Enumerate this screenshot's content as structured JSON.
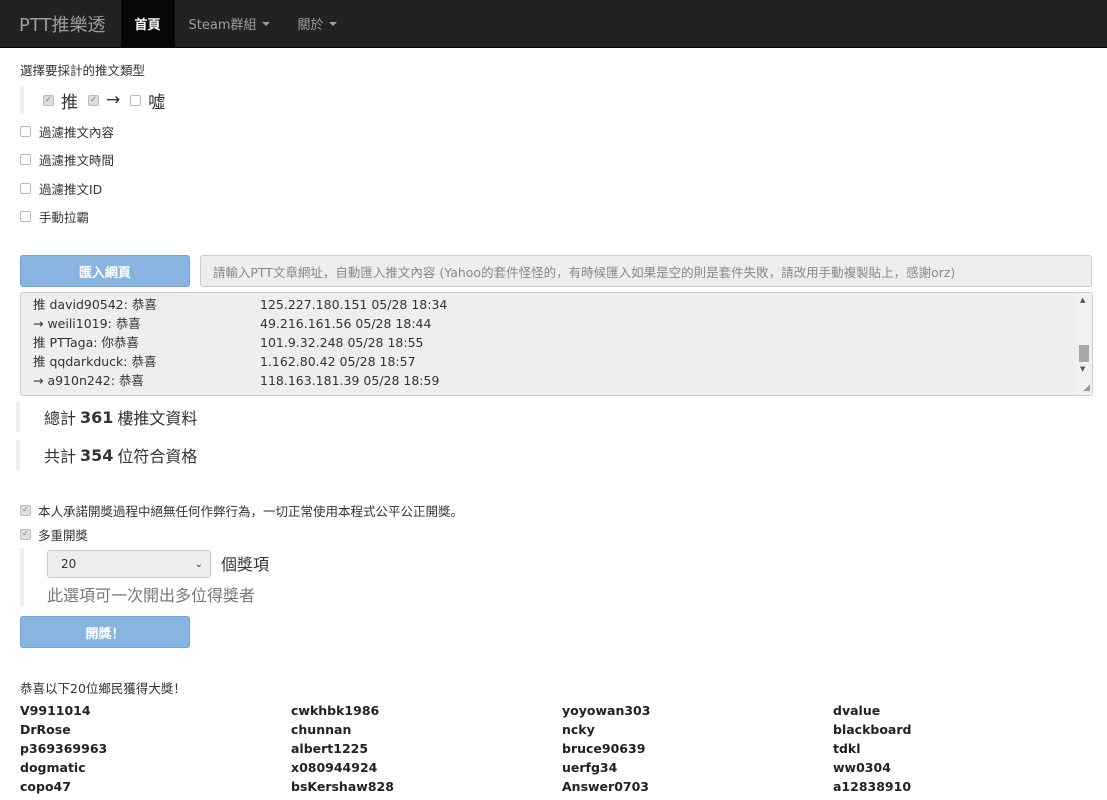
{
  "nav": {
    "brand": "PTT推樂透",
    "items": [
      {
        "label": "首頁",
        "active": true,
        "dropdown": false
      },
      {
        "label": "Steam群組",
        "active": false,
        "dropdown": true
      },
      {
        "label": "關於",
        "active": false,
        "dropdown": true
      }
    ]
  },
  "types": {
    "label": "選擇要採計的推文類型",
    "options": [
      {
        "label": "推",
        "checked": true
      },
      {
        "label": "→",
        "checked": true
      },
      {
        "label": "噓",
        "checked": false
      }
    ]
  },
  "filters": [
    {
      "label": "過濾推文內容",
      "checked": false
    },
    {
      "label": "過濾推文時間",
      "checked": false
    },
    {
      "label": "過濾推文ID",
      "checked": false
    },
    {
      "label": "手動拉霸",
      "checked": false
    }
  ],
  "import": {
    "button": "匯入網頁",
    "placeholder": "請輸入PTT文章網址，自動匯入推文內容 (Yahoo的套件怪怪的，有時候匯入如果是空的則是套件失敗，請改用手動複製貼上，感謝orz)"
  },
  "comments": [
    {
      "who": "推 david90542: 恭喜",
      "meta": "125.227.180.151 05/28 18:34"
    },
    {
      "who": "→ weili1019: 恭喜",
      "meta": "49.216.161.56 05/28 18:44"
    },
    {
      "who": "推 PTTaga: 你恭喜",
      "meta": "101.9.32.248 05/28 18:55"
    },
    {
      "who": "推 qqdarkduck: 恭喜",
      "meta": "1.162.80.42 05/28 18:57"
    },
    {
      "who": "→ a910n242: 恭喜",
      "meta": "118.163.181.39 05/28 18:59"
    }
  ],
  "stats": {
    "total_prefix": "總計",
    "total": "361",
    "total_suffix": "樓推文資料",
    "eligible_prefix": "共計",
    "eligible": "354",
    "eligible_suffix": "位符合資格"
  },
  "promise": {
    "label": "本人承諾開獎過程中絕無任何作弊行為，一切正常使用本程式公平公正開獎。",
    "checked": true
  },
  "multi": {
    "label": "多重開獎",
    "checked": true,
    "count": "20",
    "suffix": "個獎項",
    "hint": "此選項可一次開出多位得獎者"
  },
  "draw_button": "開獎！",
  "winners_title": "恭喜以下20位鄉民獲得大獎！",
  "winners": [
    "V9911014",
    "cwkhbk1986",
    "yoyowan303",
    "dvalue",
    "DrRose",
    "chunnan",
    "ncky",
    "blackboard",
    "p369369963",
    "albert1225",
    "bruce90639",
    "tdkl",
    "dogmatic",
    "x080944924",
    "uerfg34",
    "ww0304",
    "copo47",
    "bsKershaw828",
    "Answer0703",
    "a12838910"
  ]
}
